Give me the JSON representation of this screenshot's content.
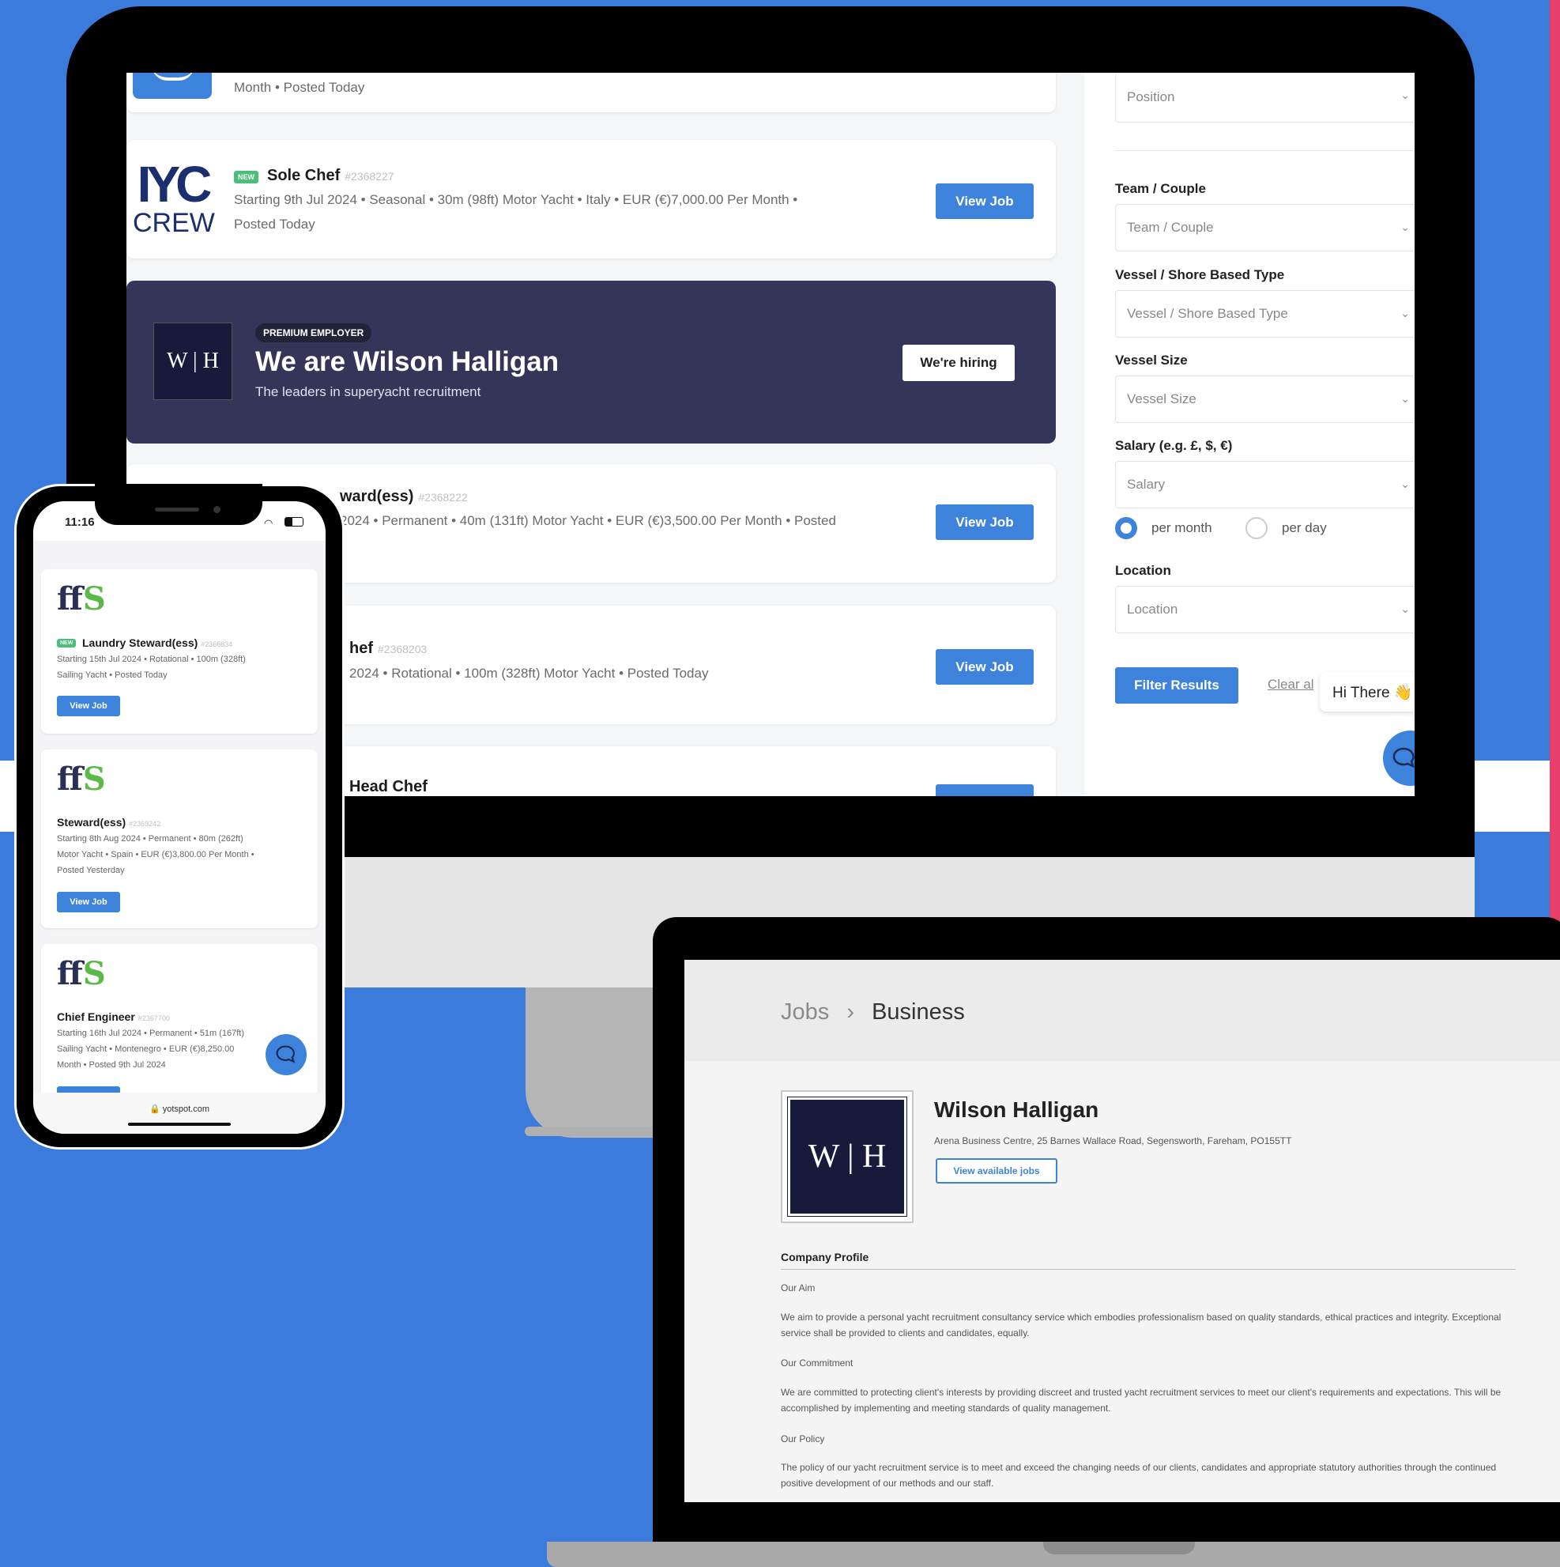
{
  "monitor": {
    "top_card": {
      "meta": "Month  •  Posted Today"
    },
    "job_sole_chef": {
      "badge": "NEW",
      "logo_line1": "IYC",
      "logo_line2": "CREW",
      "title": "Sole Chef",
      "ref": "#2368227",
      "meta_line1": "Starting 9th Jul 2024  •  Seasonal  •  30m (98ft) Motor Yacht  •  Italy  •  EUR (€)7,000.00 Per Month  •",
      "meta_line2": "Posted Today",
      "button": "View Job"
    },
    "premium_banner": {
      "logo": "W | H",
      "tag": "PREMIUM EMPLOYER",
      "title": "We are Wilson Halligan",
      "subtitle": "The leaders in superyacht recruitment",
      "button": "We're hiring"
    },
    "job_steward": {
      "title": "ward(ess)",
      "ref": "#2368222",
      "meta": "2024  •  Permanent  •  40m (131ft) Motor Yacht  •  EUR (€)3,500.00 Per Month  •  Posted",
      "button": "View Job"
    },
    "job_chef": {
      "title": "hef",
      "ref": "#2368203",
      "meta": "2024  •  Rotational  •  100m (328ft) Motor Yacht  •  Posted Today",
      "button": "View Job"
    },
    "job_head_chef": {
      "title": "Head Chef"
    },
    "filters": {
      "position": {
        "placeholder": "Position"
      },
      "team_couple": {
        "label": "Team / Couple",
        "placeholder": "Team / Couple"
      },
      "vessel_type": {
        "label": "Vessel / Shore Based Type",
        "placeholder": "Vessel / Shore Based Type"
      },
      "vessel_size": {
        "label": "Vessel Size",
        "placeholder": "Vessel Size"
      },
      "salary": {
        "label": "Salary (e.g. £, $, €)",
        "placeholder": "Salary",
        "option_month": "per month",
        "option_day": "per day",
        "selected": "per month"
      },
      "location": {
        "label": "Location",
        "placeholder": "Location"
      },
      "filter_button": "Filter Results",
      "clear_link": "Clear al",
      "chat_greeting": "Hi There 👋"
    }
  },
  "phone": {
    "time": "11:16",
    "url": "yotspot.com",
    "jobs": [
      {
        "logo": "fS",
        "badge": "NEW",
        "title": "Laundry Steward(ess)",
        "ref": "#2368834",
        "meta_line1": "Starting 15th Jul 2024  •  Rotational  •  100m (328ft)",
        "meta_line2": "Sailing Yacht  •  Posted Today",
        "meta_line3": "",
        "button": "View Job"
      },
      {
        "logo": "fS",
        "badge": "",
        "title": "Steward(ess)",
        "ref": "#2369242",
        "meta_line1": "Starting 8th Aug 2024  •  Permanent  •  80m (262ft)",
        "meta_line2": "Motor Yacht  •  Spain  •  EUR (€)3,800.00 Per Month  •",
        "meta_line3": "Posted Yesterday",
        "button": "View Job"
      },
      {
        "logo": "fS",
        "badge": "",
        "title": "Chief Engineer",
        "ref": "#2367700",
        "meta_line1": "Starting 16th Jul 2024  •  Permanent  •  51m (167ft)",
        "meta_line2": "Sailing Yacht  •  Montenegro  •  EUR (€)8,250.00",
        "meta_line3": "Month  •  Posted 9th Jul 2024",
        "button": ""
      }
    ]
  },
  "laptop": {
    "breadcrumb": {
      "jobs": "Jobs",
      "separator": "›",
      "current": "Business"
    },
    "company": {
      "logo": "W | H",
      "name": "Wilson Halligan",
      "address": "Arena Business Centre, 25 Barnes Wallace Road, Segensworth, Fareham, PO155TT",
      "view_jobs_button": "View available jobs"
    },
    "profile": {
      "heading": "Company Profile",
      "aim_heading": "Our Aim",
      "aim_text": "We aim to provide a personal yacht recruitment consultancy service which embodies professionalism based on quality standards, ethical practices and integrity. Exceptional service shall be provided to clients and candidates, equally.",
      "commitment_heading": "Our Commitment",
      "commitment_text": "We are committed to protecting client's interests by providing discreet and trusted yacht recruitment services to meet our client's requirements and expectations. This will be accomplished by implementing and meeting standards of quality management.",
      "policy_heading": "Our Policy",
      "policy_text": "The policy of our yacht recruitment service is to meet and exceed the changing needs of our clients, candidates and appropriate statutory authorities through the continued positive development of our methods and our staff."
    }
  },
  "colors": {
    "background": "#3a7bdc",
    "accent": "#3d82db",
    "banner": "#35355a",
    "new_badge": "#4bbf7a",
    "pink_edge": "#e73e6c"
  }
}
